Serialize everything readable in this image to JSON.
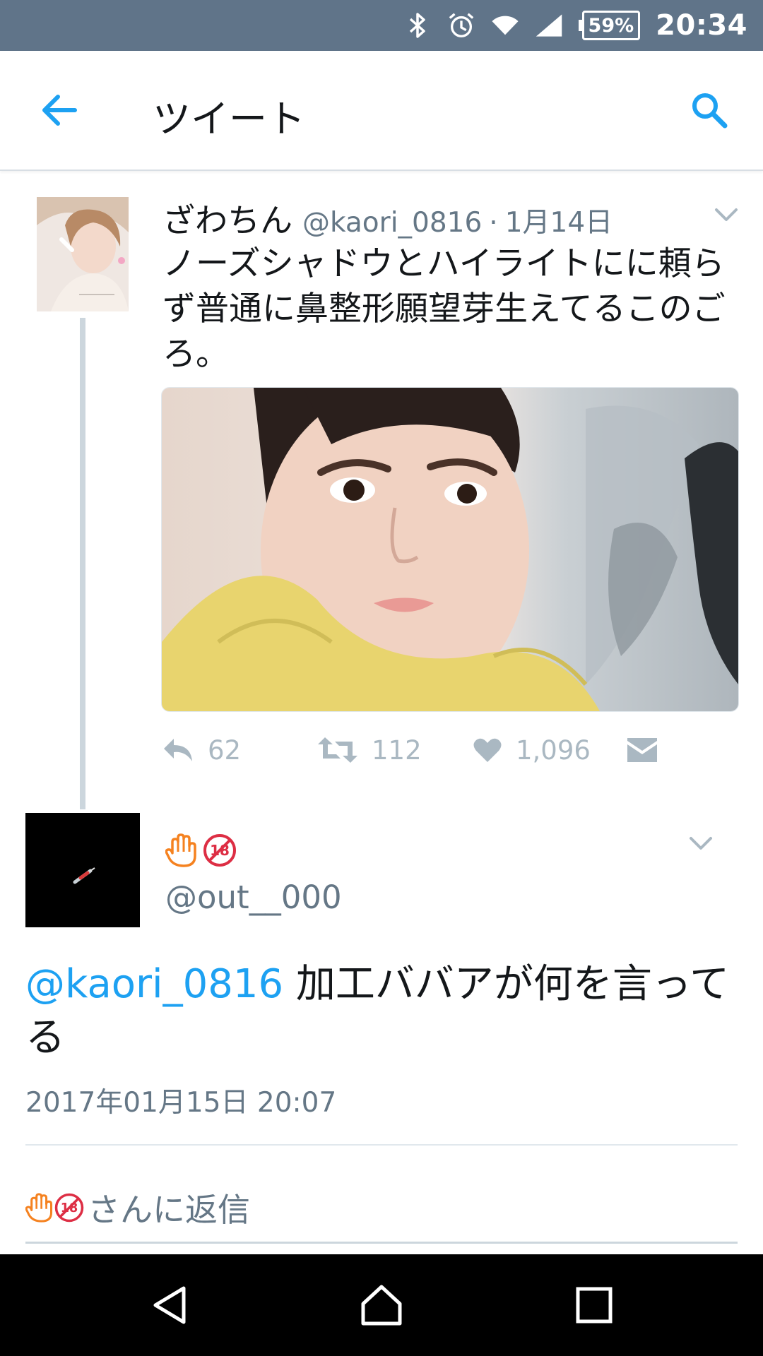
{
  "status_bar": {
    "battery": "59%",
    "time": "20:34",
    "icons": [
      "bluetooth-icon",
      "alarm-icon",
      "wifi-icon",
      "signal-icon",
      "battery-icon"
    ],
    "background": "#607489"
  },
  "toolbar": {
    "title": "ツイート",
    "back_icon": "arrow-left-icon",
    "search_icon": "search-icon",
    "accent": "#1da1f2"
  },
  "parent_tweet": {
    "display_name": "ざわちん",
    "handle": "@kaori_0816",
    "separator": "·",
    "date": "1月14日",
    "text": "ノーズシャドウとハイライトにに頼らず普通に鼻整形願望芽生えてるこのごろ。",
    "actions": {
      "reply_count": "62",
      "retweet_count": "112",
      "like_count": "1,096"
    }
  },
  "reply_tweet": {
    "display_name_emojis": [
      "raised-hand-emoji",
      "no-under-18-emoji"
    ],
    "handle": "@out__000",
    "mention": "@kaori_0816",
    "text": " 加工ババアが何を言ってる",
    "timestamp": "2017年01月15日 20:07"
  },
  "reply_bar": {
    "label": "さんに返信"
  },
  "nav_bar": {
    "buttons": [
      "back-triangle-icon",
      "home-icon",
      "recents-icon"
    ]
  }
}
